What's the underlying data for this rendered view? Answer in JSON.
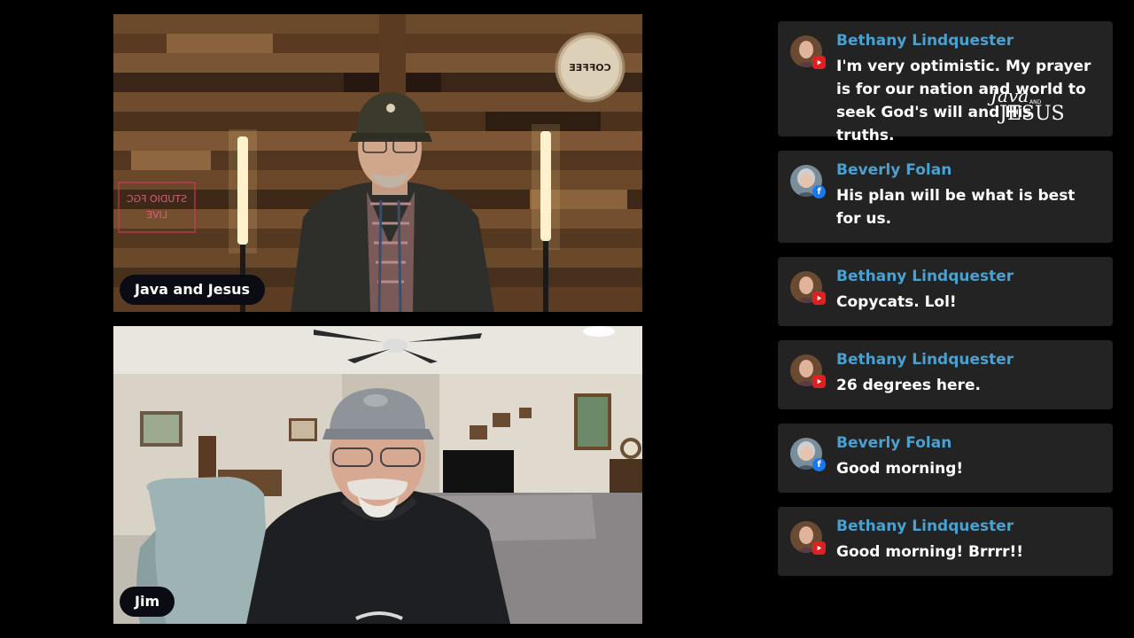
{
  "videos": {
    "top": {
      "label": "Java and Jesus",
      "neon_sign": "STUDIO FGC LIVE",
      "clock_text": "COFFEE"
    },
    "bottom": {
      "label": "Jim"
    }
  },
  "chat": [
    {
      "author": "Bethany Lindquester",
      "platform": "youtube",
      "platform_icon": "youtube-icon",
      "text": "I'm very optimistic. My prayer is for our nation and world to seek God's will and His truths."
    },
    {
      "author": "Beverly Folan",
      "platform": "facebook",
      "platform_icon": "facebook-icon",
      "text": "His plan will be what is best for us."
    },
    {
      "author": "Bethany Lindquester",
      "platform": "youtube",
      "platform_icon": "youtube-icon",
      "text": "Copycats. Lol!"
    },
    {
      "author": "Bethany Lindquester",
      "platform": "youtube",
      "platform_icon": "youtube-icon",
      "text": "26 degrees here."
    },
    {
      "author": "Beverly Folan",
      "platform": "facebook",
      "platform_icon": "facebook-icon",
      "text": "Good morning!"
    },
    {
      "author": "Bethany Lindquester",
      "platform": "youtube",
      "platform_icon": "youtube-icon",
      "text": "Good morning! Brrrr!!"
    }
  ],
  "brand": {
    "java": "Java",
    "and": "AND",
    "jesus": "JESUS"
  },
  "colors": {
    "author": "#4aa0cf",
    "card_bg": "#232323",
    "youtube": "#e02020",
    "facebook": "#1877f2"
  }
}
